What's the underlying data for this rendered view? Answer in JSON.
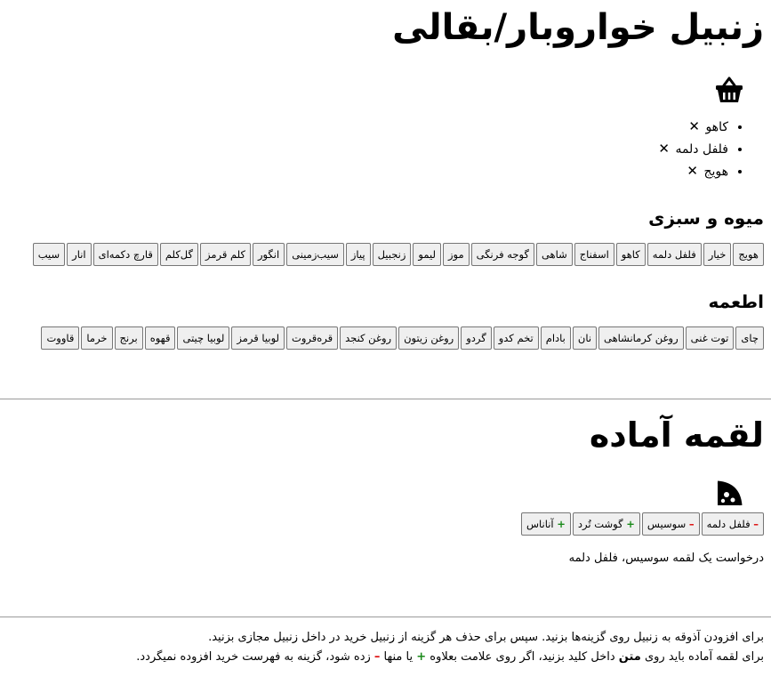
{
  "header": {
    "title": "زنبیل خواروبار/بقالی"
  },
  "cart": {
    "items": [
      {
        "label": "کاهو",
        "remove": "✕"
      },
      {
        "label": "فلفل دلمه",
        "remove": "✕"
      },
      {
        "label": "هویج",
        "remove": "✕"
      }
    ]
  },
  "produce": {
    "heading": "میوه و سبزی",
    "items": [
      "هویج",
      "خیار",
      "فلفل دلمه",
      "کاهو",
      "اسفناج",
      "شاهی",
      "گوجه فرنگی",
      "موز",
      "لیمو",
      "زنجبیل",
      "پیاز",
      "سیب‌زمینی",
      "انگور",
      "کلم قرمز",
      "گل‌کلم",
      "قارچ دکمه‌ای",
      "انار",
      "سیب"
    ]
  },
  "food": {
    "heading": "اطعمه",
    "items": [
      "چای",
      "توت غنی",
      "روغن کرمانشاهی",
      "نان",
      "بادام",
      "تخم کدو",
      "گردو",
      "روغن زیتون",
      "روغن کنجد",
      "قره‌قروت",
      "لوبیا قرمز",
      "لوبیا چیتی",
      "قهوه",
      "برنج",
      "خرما",
      "قاووت"
    ]
  },
  "meal": {
    "title": "لقمه آماده",
    "options": [
      {
        "sign": "–",
        "label": "فلفل دلمه"
      },
      {
        "sign": "–",
        "label": "سوسیس"
      },
      {
        "sign": "+",
        "label": "گوشت تُرد"
      },
      {
        "sign": "+",
        "label": "آناناس"
      }
    ],
    "request": "درخواست یک لقمه سوسیس، فلفل دلمه"
  },
  "help": {
    "line1": "برای افزودن آذوقه به زنبیل روی گزینه‌ها بزنید. سپس برای حذف هر گزینه از زنبیل خرید در داخل زنبیل مجازی بزنید.",
    "line2_a": "برای لقمه آماده باید روی ",
    "line2_bold": "متن",
    "line2_b": " داخل کلید بزنید، اگر روی علامت بعلاوه ",
    "line2_plus": "+",
    "line2_c": " یا منها ",
    "line2_minus": "–",
    "line2_d": " زده شود، گزینه به فهرست خرید افزوده نمیگردد."
  },
  "colors": {
    "plus": "#1a8a1a",
    "minus": "#d11111"
  }
}
